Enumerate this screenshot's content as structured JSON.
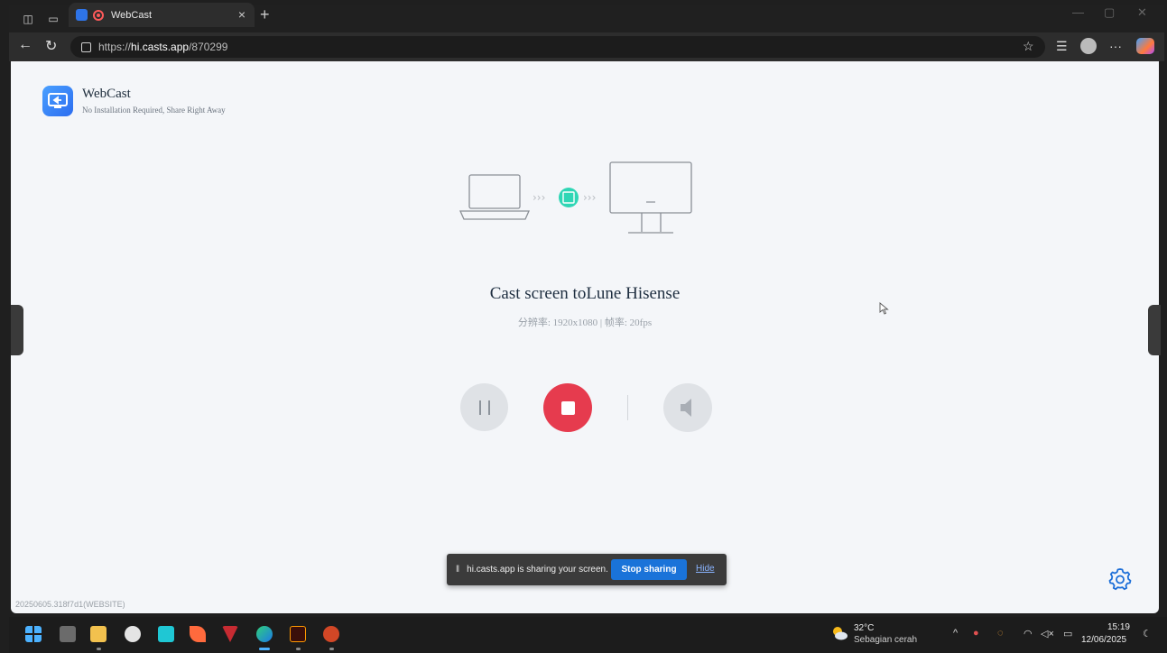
{
  "browser": {
    "tab_title": "WebCast",
    "tab_close": "×",
    "new_tab": "+",
    "url_prefix": "https://",
    "url_host": "hi.casts.app",
    "url_path": "/870299"
  },
  "app": {
    "brand": "WebCast",
    "tagline": "No Installation Required, Share Right Away",
    "cast_title": "Cast screen toLune Hisense",
    "cast_info": "分辨率: 1920x1080 | 帧率: 20fps",
    "version": "20250605.318f7d1(WEBSITE)"
  },
  "share_bar": {
    "message": "hi.casts.app is sharing your screen.",
    "stop_label": "Stop sharing",
    "hide_label": "Hide"
  },
  "taskbar": {
    "temperature": "32°C",
    "condition": "Sebagian cerah",
    "time": "15:19",
    "date": "12/06/2025"
  },
  "colors": {
    "stop_button": "#e63b4e",
    "stop_sharing_button": "#1a73d9",
    "logo": "#2c6df0",
    "illustration_badge": "#2fd6b5"
  }
}
